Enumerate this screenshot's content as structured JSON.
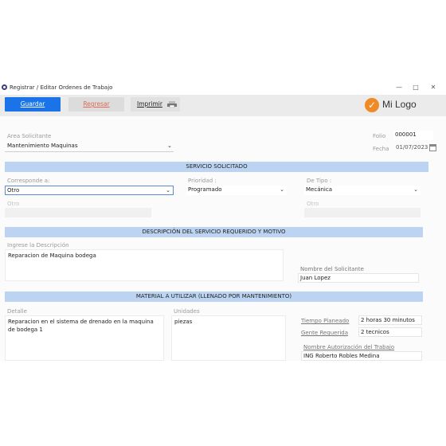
{
  "window": {
    "title": "Registrar / Editar Ordenes de Trabajo",
    "minimize": "—",
    "maximize": "□",
    "close": "✕"
  },
  "toolbar": {
    "guardar": "Guardar",
    "regresar": "Regresar",
    "imprimir": "Imprimir",
    "logo_text": "Mi Logo",
    "logo_mark": "✓"
  },
  "header": {
    "area_label": "Area Solicitante",
    "area_value": "Mantenimiento Maquinas",
    "folio_label": "Folio",
    "folio_value": "000001",
    "fecha_label": "Fecha",
    "fecha_value": "01/07/2023"
  },
  "servicio": {
    "title": "SERVICIO SOLICITADO",
    "corresponde_label": "Corresponde a:",
    "corresponde_value": "Otro",
    "prioridad_label": "Prioridad :",
    "prioridad_value": "Programado",
    "tipo_label": "De Tipo :",
    "tipo_value": "Mecánica",
    "otro1_label": "Otro",
    "otro2_label": "Otro"
  },
  "descripcion": {
    "title": "DESCRIPCIÓN DEL SERVICIO REQUERIDO Y MOTIVO",
    "placeholder": "Ingrese la Descripción",
    "text": "Reparacion de Maquina bodega",
    "solicitante_label": "Nombre del Solicitante",
    "solicitante_value": "Juan Lopez"
  },
  "material": {
    "title": "MATERIAL A UTILIZAR (LLENADO POR MANTENIMIENTO)",
    "detalle_label": "Detalle",
    "detalle_text": "Reparacion en el sistema de drenado en la maquina de bodega 1",
    "unidades_label": "Unidades",
    "unidades_text": "piezas",
    "tiempo_label": "Tiempo Planeado",
    "tiempo_value": "2 horas 30 minutos",
    "gente_label": "Gente Requerida",
    "gente_value": "2 tecnicos",
    "autorizacion_label": "Nombre Autorización del Trabajo",
    "autorizacion_value": "ING Roberto Robles Medina"
  }
}
